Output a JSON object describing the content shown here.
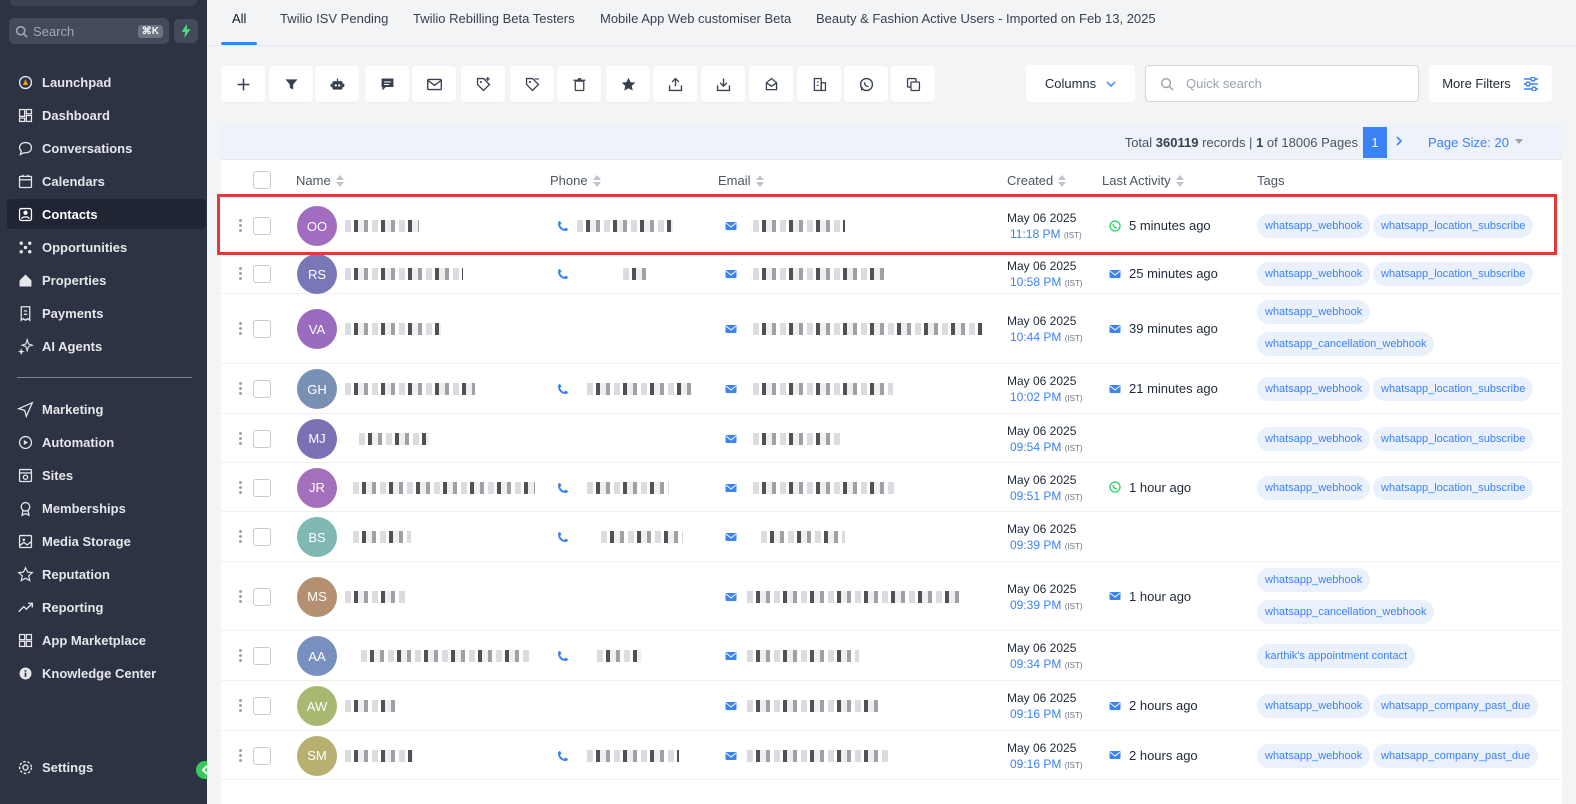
{
  "sidebar": {
    "search_placeholder": "Search",
    "shortcut": "⌘K",
    "items": [
      {
        "label": "Launchpad",
        "icon": "launchpad-icon"
      },
      {
        "label": "Dashboard",
        "icon": "dashboard-icon"
      },
      {
        "label": "Conversations",
        "icon": "chat-bubble-icon"
      },
      {
        "label": "Calendars",
        "icon": "calendar-icon"
      },
      {
        "label": "Contacts",
        "icon": "contacts-icon",
        "active": true
      },
      {
        "label": "Opportunities",
        "icon": "opportunities-icon"
      },
      {
        "label": "Properties",
        "icon": "house-icon"
      },
      {
        "label": "Payments",
        "icon": "receipt-icon"
      },
      {
        "label": "AI Agents",
        "icon": "sparkle-icon"
      },
      {
        "label": "Marketing",
        "icon": "send-icon"
      },
      {
        "label": "Automation",
        "icon": "automation-icon"
      },
      {
        "label": "Sites",
        "icon": "globe-icon"
      },
      {
        "label": "Memberships",
        "icon": "award-icon"
      },
      {
        "label": "Media Storage",
        "icon": "image-icon"
      },
      {
        "label": "Reputation",
        "icon": "star-icon"
      },
      {
        "label": "Reporting",
        "icon": "trend-icon"
      },
      {
        "label": "App Marketplace",
        "icon": "grid-icon"
      },
      {
        "label": "Knowledge Center",
        "icon": "info-icon"
      }
    ],
    "settings_label": "Settings"
  },
  "tabs": [
    {
      "label": "All",
      "active": true
    },
    {
      "label": "Twilio ISV Pending"
    },
    {
      "label": "Twilio Rebilling Beta Testers"
    },
    {
      "label": "Mobile App Web customiser Beta"
    },
    {
      "label": "Beauty & Fashion Active Users - Imported on Feb 13, 2025"
    }
  ],
  "toolbar": {
    "buttons": [
      "add-icon",
      "filter-icon",
      "robot-icon",
      "message-icon",
      "email-icon",
      "tag-add-icon",
      "tag-remove-icon",
      "trash-icon",
      "star-icon",
      "export-icon",
      "import-icon",
      "merge-icon",
      "company-icon",
      "whatsapp-icon",
      "duplicate-icon"
    ],
    "columns_label": "Columns",
    "quick_search_placeholder": "Quick search",
    "more_filters_label": "More Filters"
  },
  "pagination": {
    "total_prefix": "Total",
    "total_records": "360119",
    "records_word": "records |",
    "current_page": "1",
    "of_text": "of 18006 Pages",
    "page_size": "Page Size: 20"
  },
  "columns": {
    "name": "Name",
    "phone": "Phone",
    "email": "Email",
    "created": "Created",
    "last_activity": "Last Activity",
    "tags": "Tags"
  },
  "colors": {
    "accent": "#3b82f6",
    "sidebar_bg": "#2c3342",
    "highlight": "#e53935",
    "whatsapp": "#25d366"
  },
  "rows": [
    {
      "initials": "OO",
      "avatar_color": "#a26cc0",
      "has_phone": true,
      "date": "May 06 2025",
      "time": "11:18 PM",
      "tz": "(IST)",
      "activity": "5 minutes ago",
      "activity_icon": "whatsapp-icon",
      "tags": [
        "whatsapp_webhook",
        "whatsapp_location_subscribe"
      ]
    },
    {
      "initials": "RS",
      "avatar_color": "#7878b8",
      "has_phone": true,
      "date": "May 06 2025",
      "time": "10:58 PM",
      "tz": "(IST)",
      "activity": "25 minutes ago",
      "activity_icon": "email-icon",
      "tags": [
        "whatsapp_webhook",
        "whatsapp_location_subscribe"
      ]
    },
    {
      "initials": "VA",
      "avatar_color": "#9a6cc0",
      "has_phone": false,
      "date": "May 06 2025",
      "time": "10:44 PM",
      "tz": "(IST)",
      "activity": "39 minutes ago",
      "activity_icon": "email-icon",
      "tags": [
        "whatsapp_webhook",
        "whatsapp_cancellation_webhook"
      ]
    },
    {
      "initials": "GH",
      "avatar_color": "#7890b4",
      "has_phone": true,
      "date": "May 06 2025",
      "time": "10:02 PM",
      "tz": "(IST)",
      "activity": "21 minutes ago",
      "activity_icon": "email-icon",
      "tags": [
        "whatsapp_webhook",
        "whatsapp_location_subscribe"
      ]
    },
    {
      "initials": "MJ",
      "avatar_color": "#7c70b4",
      "has_phone": false,
      "date": "May 06 2025",
      "time": "09:54 PM",
      "tz": "(IST)",
      "activity": "",
      "activity_icon": "",
      "tags": [
        "whatsapp_webhook",
        "whatsapp_location_subscribe"
      ]
    },
    {
      "initials": "JR",
      "avatar_color": "#a470bc",
      "has_phone": true,
      "date": "May 06 2025",
      "time": "09:51 PM",
      "tz": "(IST)",
      "activity": "1 hour ago",
      "activity_icon": "whatsapp-icon",
      "tags": [
        "whatsapp_webhook",
        "whatsapp_location_subscribe"
      ]
    },
    {
      "initials": "BS",
      "avatar_color": "#80b8b4",
      "has_phone": true,
      "date": "May 06 2025",
      "time": "09:39 PM",
      "tz": "(IST)",
      "activity": "",
      "activity_icon": "",
      "tags": []
    },
    {
      "initials": "MS",
      "avatar_color": "#b49070",
      "has_phone": false,
      "date": "May 06 2025",
      "time": "09:39 PM",
      "tz": "(IST)",
      "activity": "1 hour ago",
      "activity_icon": "email-icon",
      "tags": [
        "whatsapp_webhook",
        "whatsapp_cancellation_webhook"
      ]
    },
    {
      "initials": "AA",
      "avatar_color": "#7890c0",
      "has_phone": true,
      "date": "May 06 2025",
      "time": "09:34 PM",
      "tz": "(IST)",
      "activity": "",
      "activity_icon": "",
      "tags": [
        "karthik's appointment contact"
      ]
    },
    {
      "initials": "AW",
      "avatar_color": "#a8b870",
      "has_phone": false,
      "date": "May 06 2025",
      "time": "09:16 PM",
      "tz": "(IST)",
      "activity": "2 hours ago",
      "activity_icon": "email-icon",
      "tags": [
        "whatsapp_webhook",
        "whatsapp_company_past_due"
      ]
    },
    {
      "initials": "SM",
      "avatar_color": "#b8b070",
      "has_phone": true,
      "date": "May 06 2025",
      "time": "09:16 PM",
      "tz": "(IST)",
      "activity": "2 hours ago",
      "activity_icon": "email-icon",
      "tags": [
        "whatsapp_webhook",
        "whatsapp_company_past_due"
      ]
    }
  ]
}
